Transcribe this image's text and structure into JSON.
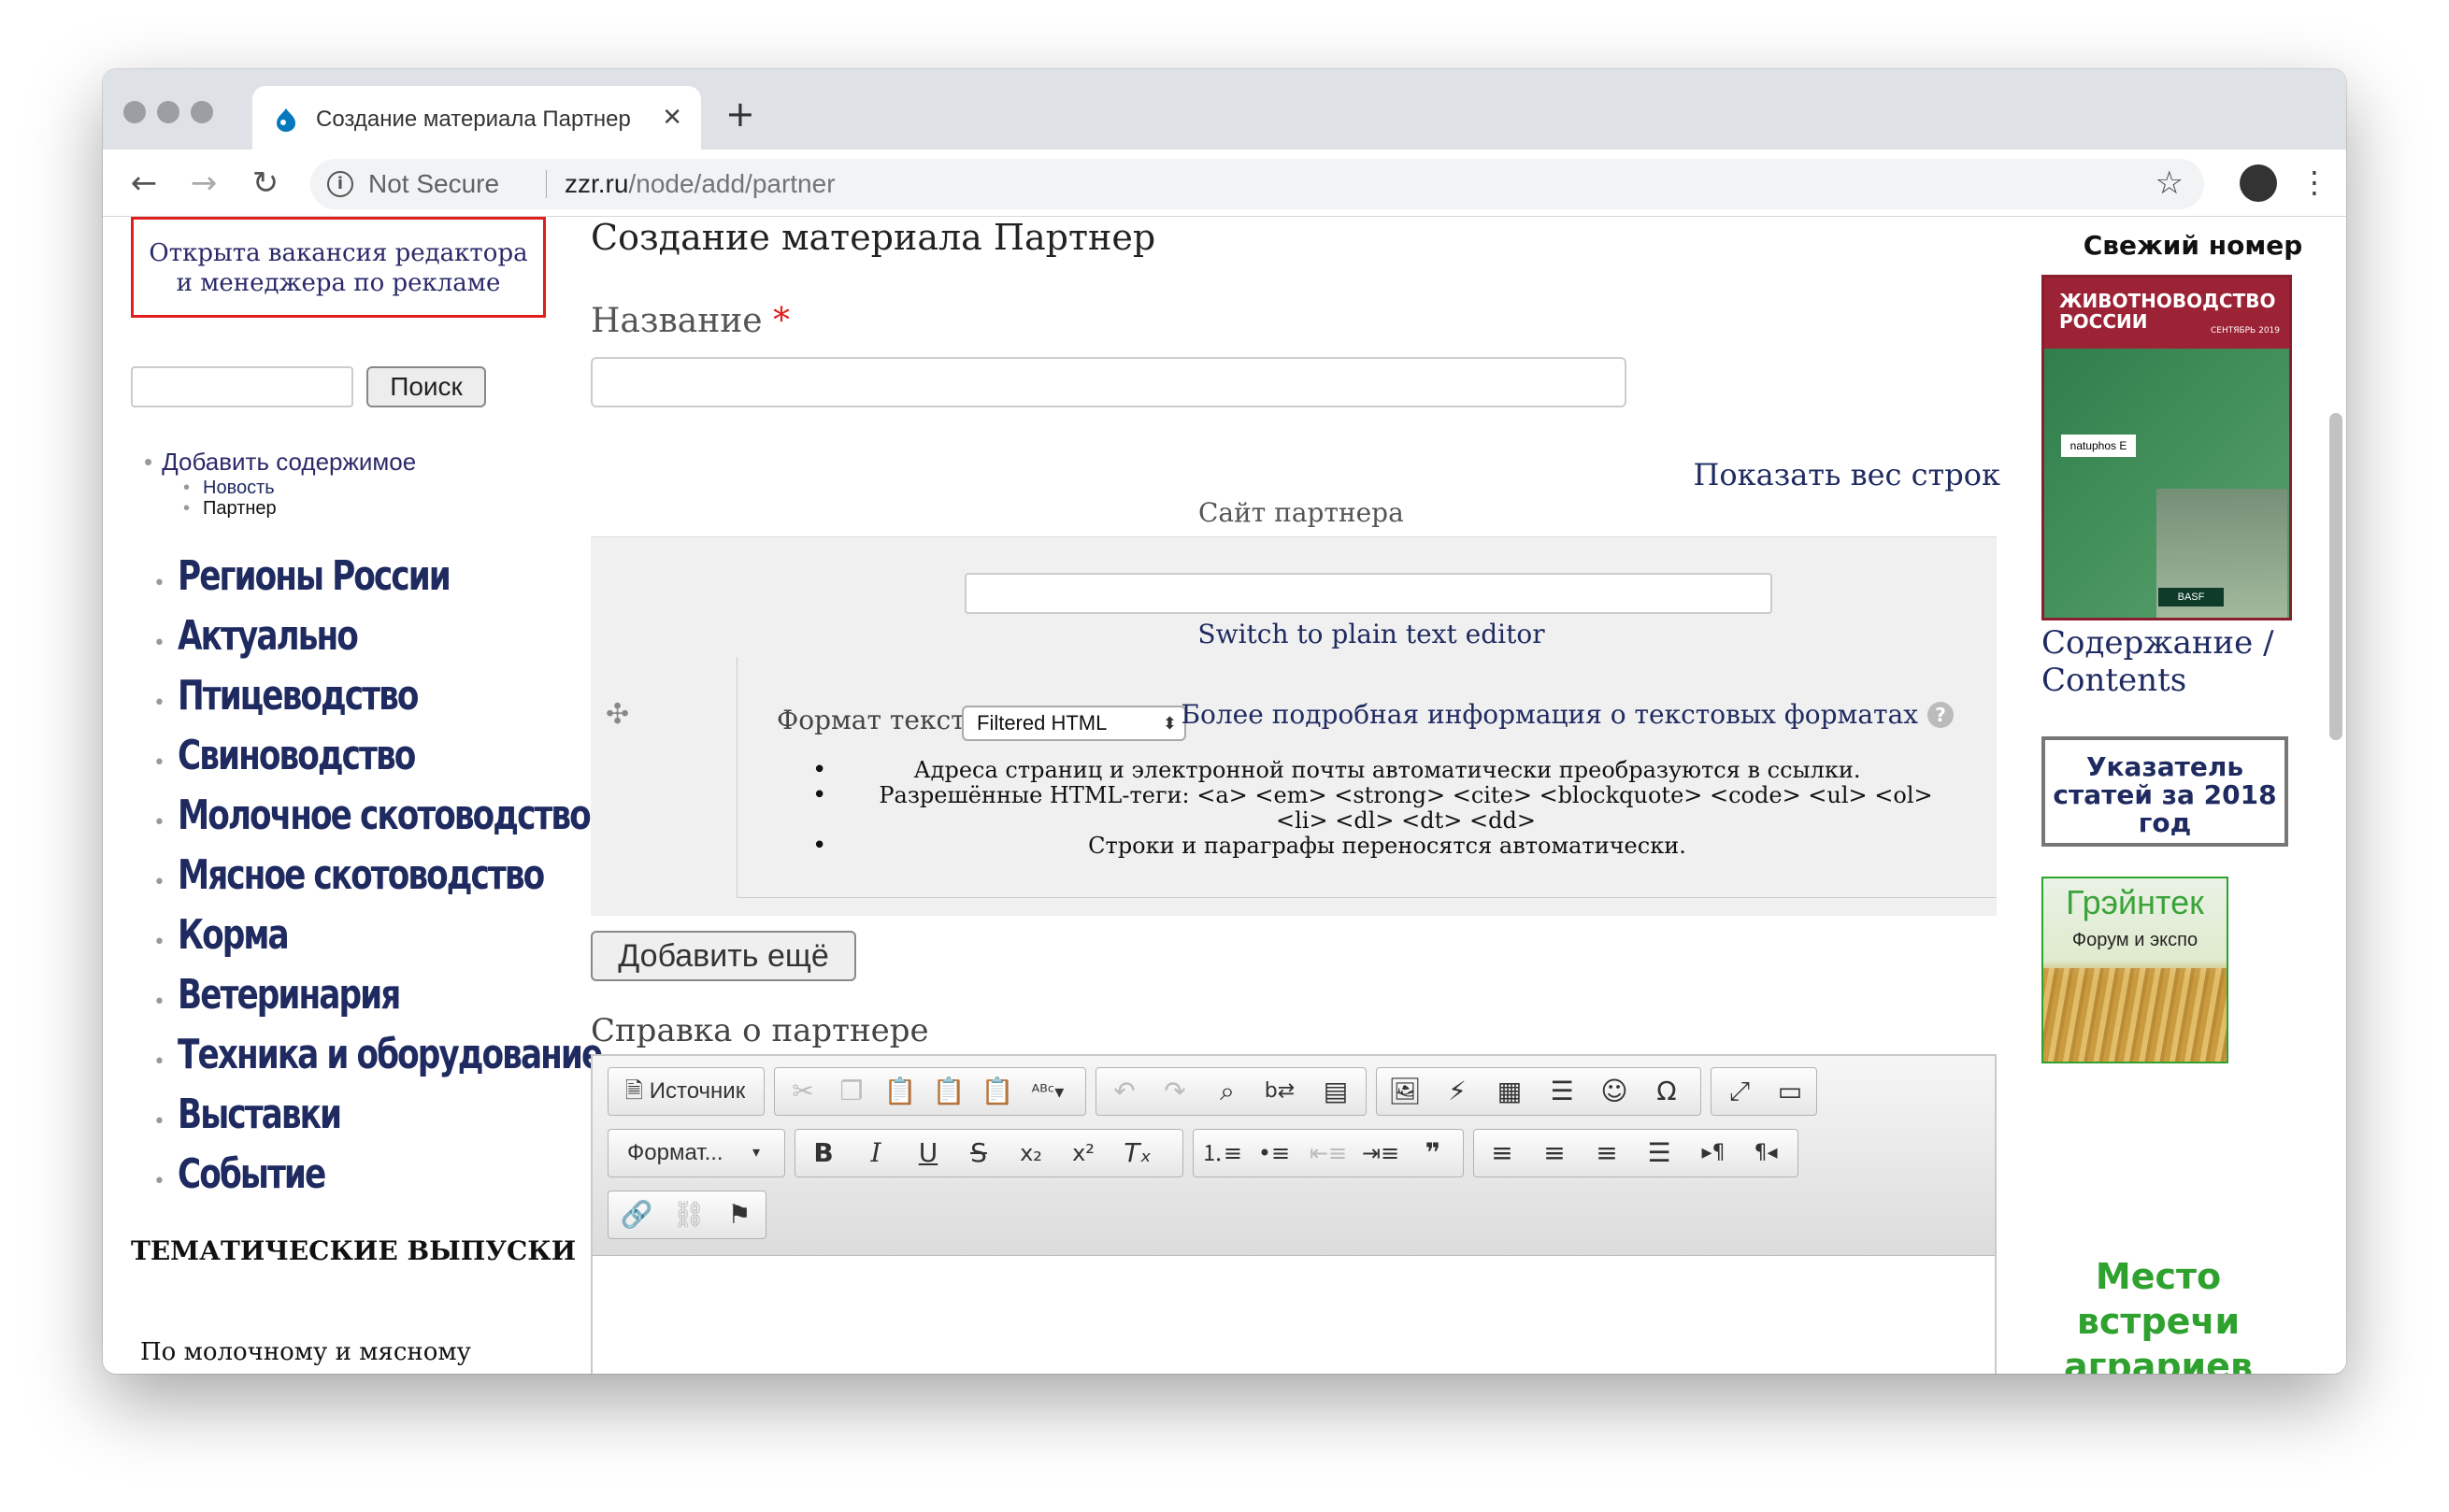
{
  "browser": {
    "tab_title": "Создание материала Партнер",
    "tab_close": "✕",
    "new_tab": "+",
    "security_label": "Not Secure",
    "url_host": "zzr.ru",
    "url_path": "/node/add/partner",
    "back": "←",
    "forward": "→",
    "reload": "↻",
    "star": "☆",
    "menu": "⋮"
  },
  "sidebar_left": {
    "vacancy_line1": "Открыта вакансия редактора",
    "vacancy_line2": "и менеджера по рекламе",
    "search_button": "Поиск",
    "add_content": "Добавить содержимое",
    "sub_items": [
      "Новость",
      "Партнер"
    ],
    "nav": [
      "Регионы России",
      "Актуально",
      "Птицеводство",
      "Свиноводство",
      "Молочное скотоводство",
      "Мясное скотоводство",
      "Корма",
      "Ветеринария",
      "Техника и оборудование",
      "Выставки",
      "Событие"
    ],
    "thematic_title": "ТЕМАТИЧЕСКИЕ ВЫПУСКИ",
    "thematic_sub": "По молочному и мясному"
  },
  "main": {
    "page_title": "Создание материала Партнер",
    "name_label": "Название",
    "required_mark": "*",
    "show_weight": "Показать вес строк",
    "partner_site_label": "Сайт партнера",
    "switch_plain": "Switch to plain text editor",
    "format_label": "Формат текста",
    "format_value": "Filtered HTML",
    "format_more": "Более подробная информация о текстовых форматах",
    "tips": [
      "Адреса страниц и электронной почты автоматически преобразуются в ссылки.",
      "Разрешённые HTML-теги: <a> <em> <strong> <cite> <blockquote> <code> <ul> <ol> <li> <dl> <dt> <dd>",
      "Строки и параграфы переносятся автоматически."
    ],
    "add_more_button": "Добавить ещё",
    "about_partner_label": "Справка о партнере",
    "editor": {
      "source_button": "Источник",
      "format_dropdown": "Формат..."
    }
  },
  "sidebar_right": {
    "fresh_issue": "Свежий номер",
    "cover_title": "ЖИВОТНОВОДСТВО РОССИИ",
    "cover_date": "СЕНТЯБРЬ 2019",
    "cover_label": "natuphos E",
    "cover_brand": "BASF",
    "contents_link": "Содержание / Contents",
    "index_box": "Указатель статей за 2018 год",
    "graintek_title": "Грэйнтек",
    "graintek_sub": "Форум и экспо",
    "meeting": "Место встречи аграриев"
  },
  "colors": {
    "link": "#1f2b60",
    "vacancy_border": "#e01e1e",
    "accent_green": "#2ea12e"
  }
}
